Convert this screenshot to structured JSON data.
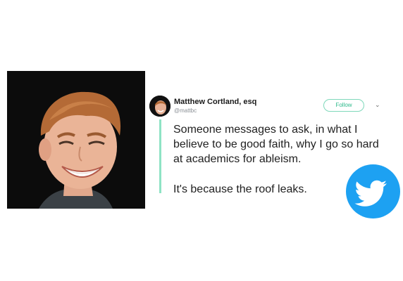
{
  "tweet": {
    "author_name": "Matthew Cortland, esq",
    "author_handle": "@mattbc",
    "follow_label": "Follow",
    "menu_icon": "chevron-down-icon",
    "paragraphs": [
      "Someone messages to ask, in what I believe to be good faith, why I go so hard at academics for ableism.",
      "It's because the roof leaks."
    ]
  },
  "badge": {
    "icon": "twitter-bird-icon",
    "color": "#1da1f2"
  },
  "colors": {
    "accent": "#2bb98a",
    "rule": "#8fe3c5"
  }
}
